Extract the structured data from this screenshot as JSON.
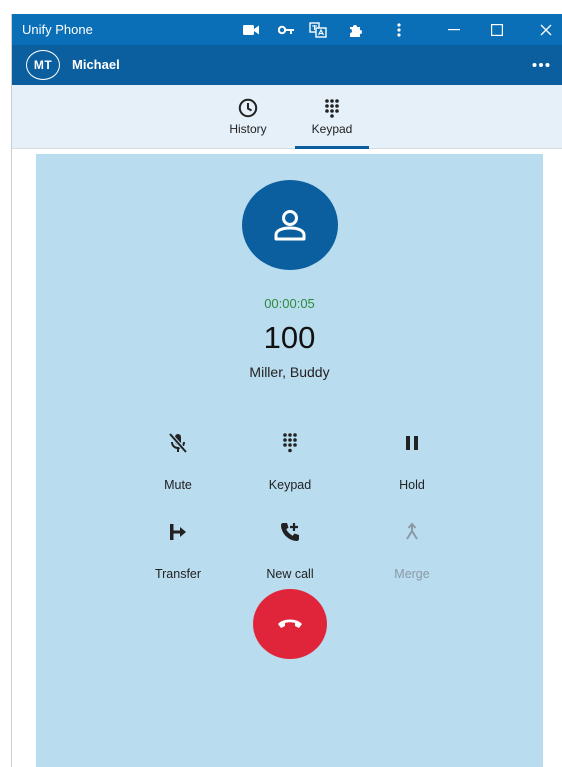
{
  "window": {
    "title": "Unify Phone",
    "titlebar_icons": [
      "video-camera-icon",
      "key-icon",
      "translate-icon",
      "puzzle-icon",
      "kebab-menu-icon",
      "minimize-icon",
      "maximize-icon",
      "close-icon"
    ]
  },
  "user": {
    "initials": "MT",
    "name": "Michael",
    "menu_icon": "more-horizontal-icon"
  },
  "tabs": [
    {
      "label": "History",
      "icon": "clock-icon",
      "active": false
    },
    {
      "label": "Keypad",
      "icon": "dialpad-icon",
      "active": true
    }
  ],
  "call": {
    "timer": "00:00:05",
    "number": "100",
    "caller_name": "Miller, Buddy",
    "controls": [
      {
        "label": "Mute",
        "icon": "mic-off-icon",
        "enabled": true
      },
      {
        "label": "Keypad",
        "icon": "dialpad-icon",
        "enabled": true
      },
      {
        "label": "Hold",
        "icon": "pause-icon",
        "enabled": true
      },
      {
        "label": "Transfer",
        "icon": "transfer-icon",
        "enabled": true
      },
      {
        "label": "New call",
        "icon": "add-call-icon",
        "enabled": true
      },
      {
        "label": "Merge",
        "icon": "merge-icon",
        "enabled": false
      }
    ],
    "hangup_icon": "hangup-icon"
  },
  "colors": {
    "titlebar": "#0a6fb6",
    "userbar": "#0b5f9f",
    "tabbar": "#e5f0f8",
    "panel": "#b9dcef",
    "accent": "#0b5f9f",
    "timer": "#2e8b3a",
    "hangup": "#e0253a"
  }
}
